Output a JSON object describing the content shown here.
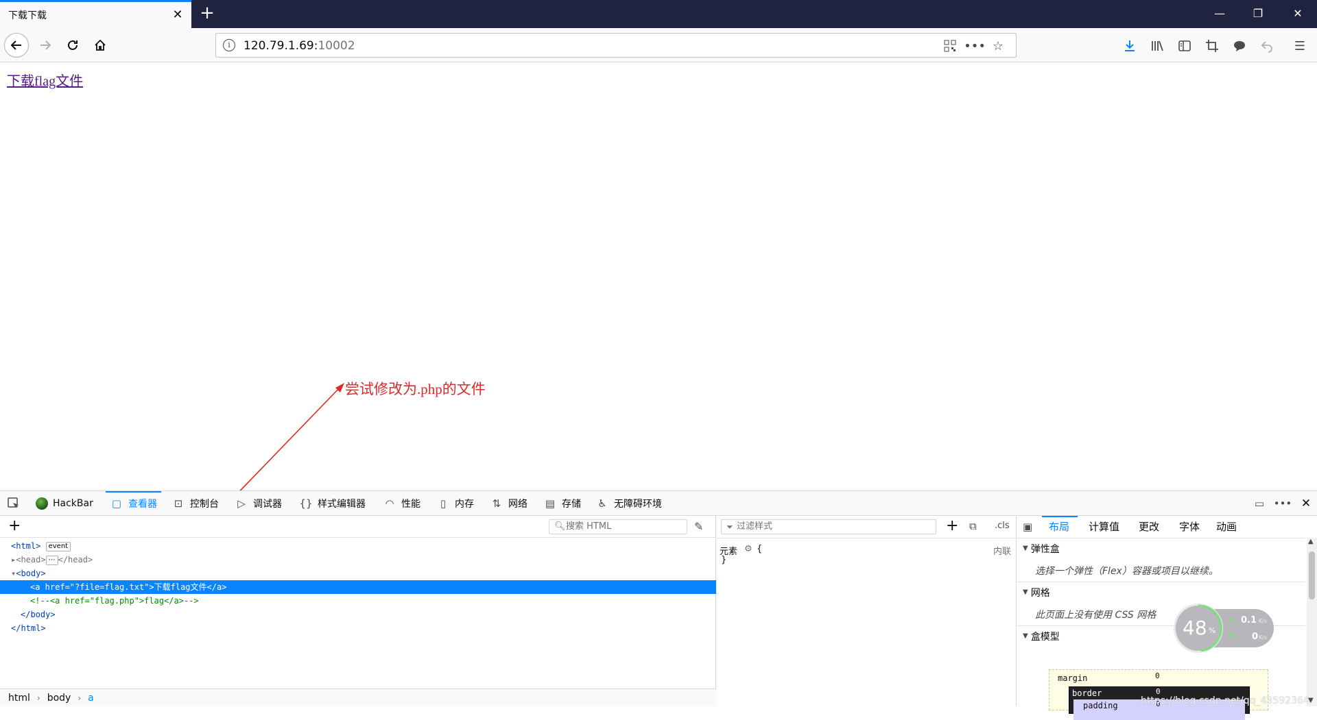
{
  "browser": {
    "tab_title": "下载下载",
    "url_host": "120.79.1.69:",
    "url_port": "10002"
  },
  "page": {
    "link_text": "下载flag文件",
    "annotation": "尝试修改为.php的文件"
  },
  "devtools": {
    "tabs": [
      "HackBar",
      "查看器",
      "控制台",
      "调试器",
      "样式编辑器",
      "性能",
      "内存",
      "网络",
      "存储",
      "无障碍环境"
    ],
    "active_tab": "查看器",
    "search_placeholder": "搜索 HTML",
    "markup": {
      "html_open": "<html>",
      "event_badge": "event",
      "head": "<head>",
      "head_close": "</head>",
      "body_open": "<body>",
      "selected_line": "<a href=\"?file=flag.txt\">下载flag文件</a>",
      "comment_line": "<!--<a href=\"flag.php\">flag</a>-->",
      "body_close": "</body>",
      "html_close": "</html>"
    },
    "breadcrumbs": [
      "html",
      "body",
      "a"
    ],
    "rules": {
      "filter_placeholder": "过滤样式",
      "cls": ".cls",
      "element_label": "元素",
      "inline_label": "内联",
      "brace_open": "{",
      "brace_close": "}"
    },
    "layout_tabs": [
      "布局",
      "计算值",
      "更改",
      "字体",
      "动画"
    ],
    "active_layout_tab": "布局",
    "sections": {
      "flexbox": "弹性盒",
      "flexbox_desc": "选择一个弹性（Flex）容器或项目以继续。",
      "grid": "网格",
      "grid_desc": "此页面上没有使用 CSS 网格",
      "boxmodel": "盒模型"
    },
    "boxmodel": {
      "margin": "margin",
      "border": "border",
      "padding": "padding",
      "margin_top": "0",
      "border_top": "0",
      "padding_top": "0"
    },
    "speed_widget": {
      "percent": "48",
      "percent_sign": "%",
      "up": "0.1",
      "up_unit": "K/s",
      "down": "0",
      "down_unit": "K/s"
    }
  },
  "watermark": "https://blog.csdn.net/qq_43592364"
}
